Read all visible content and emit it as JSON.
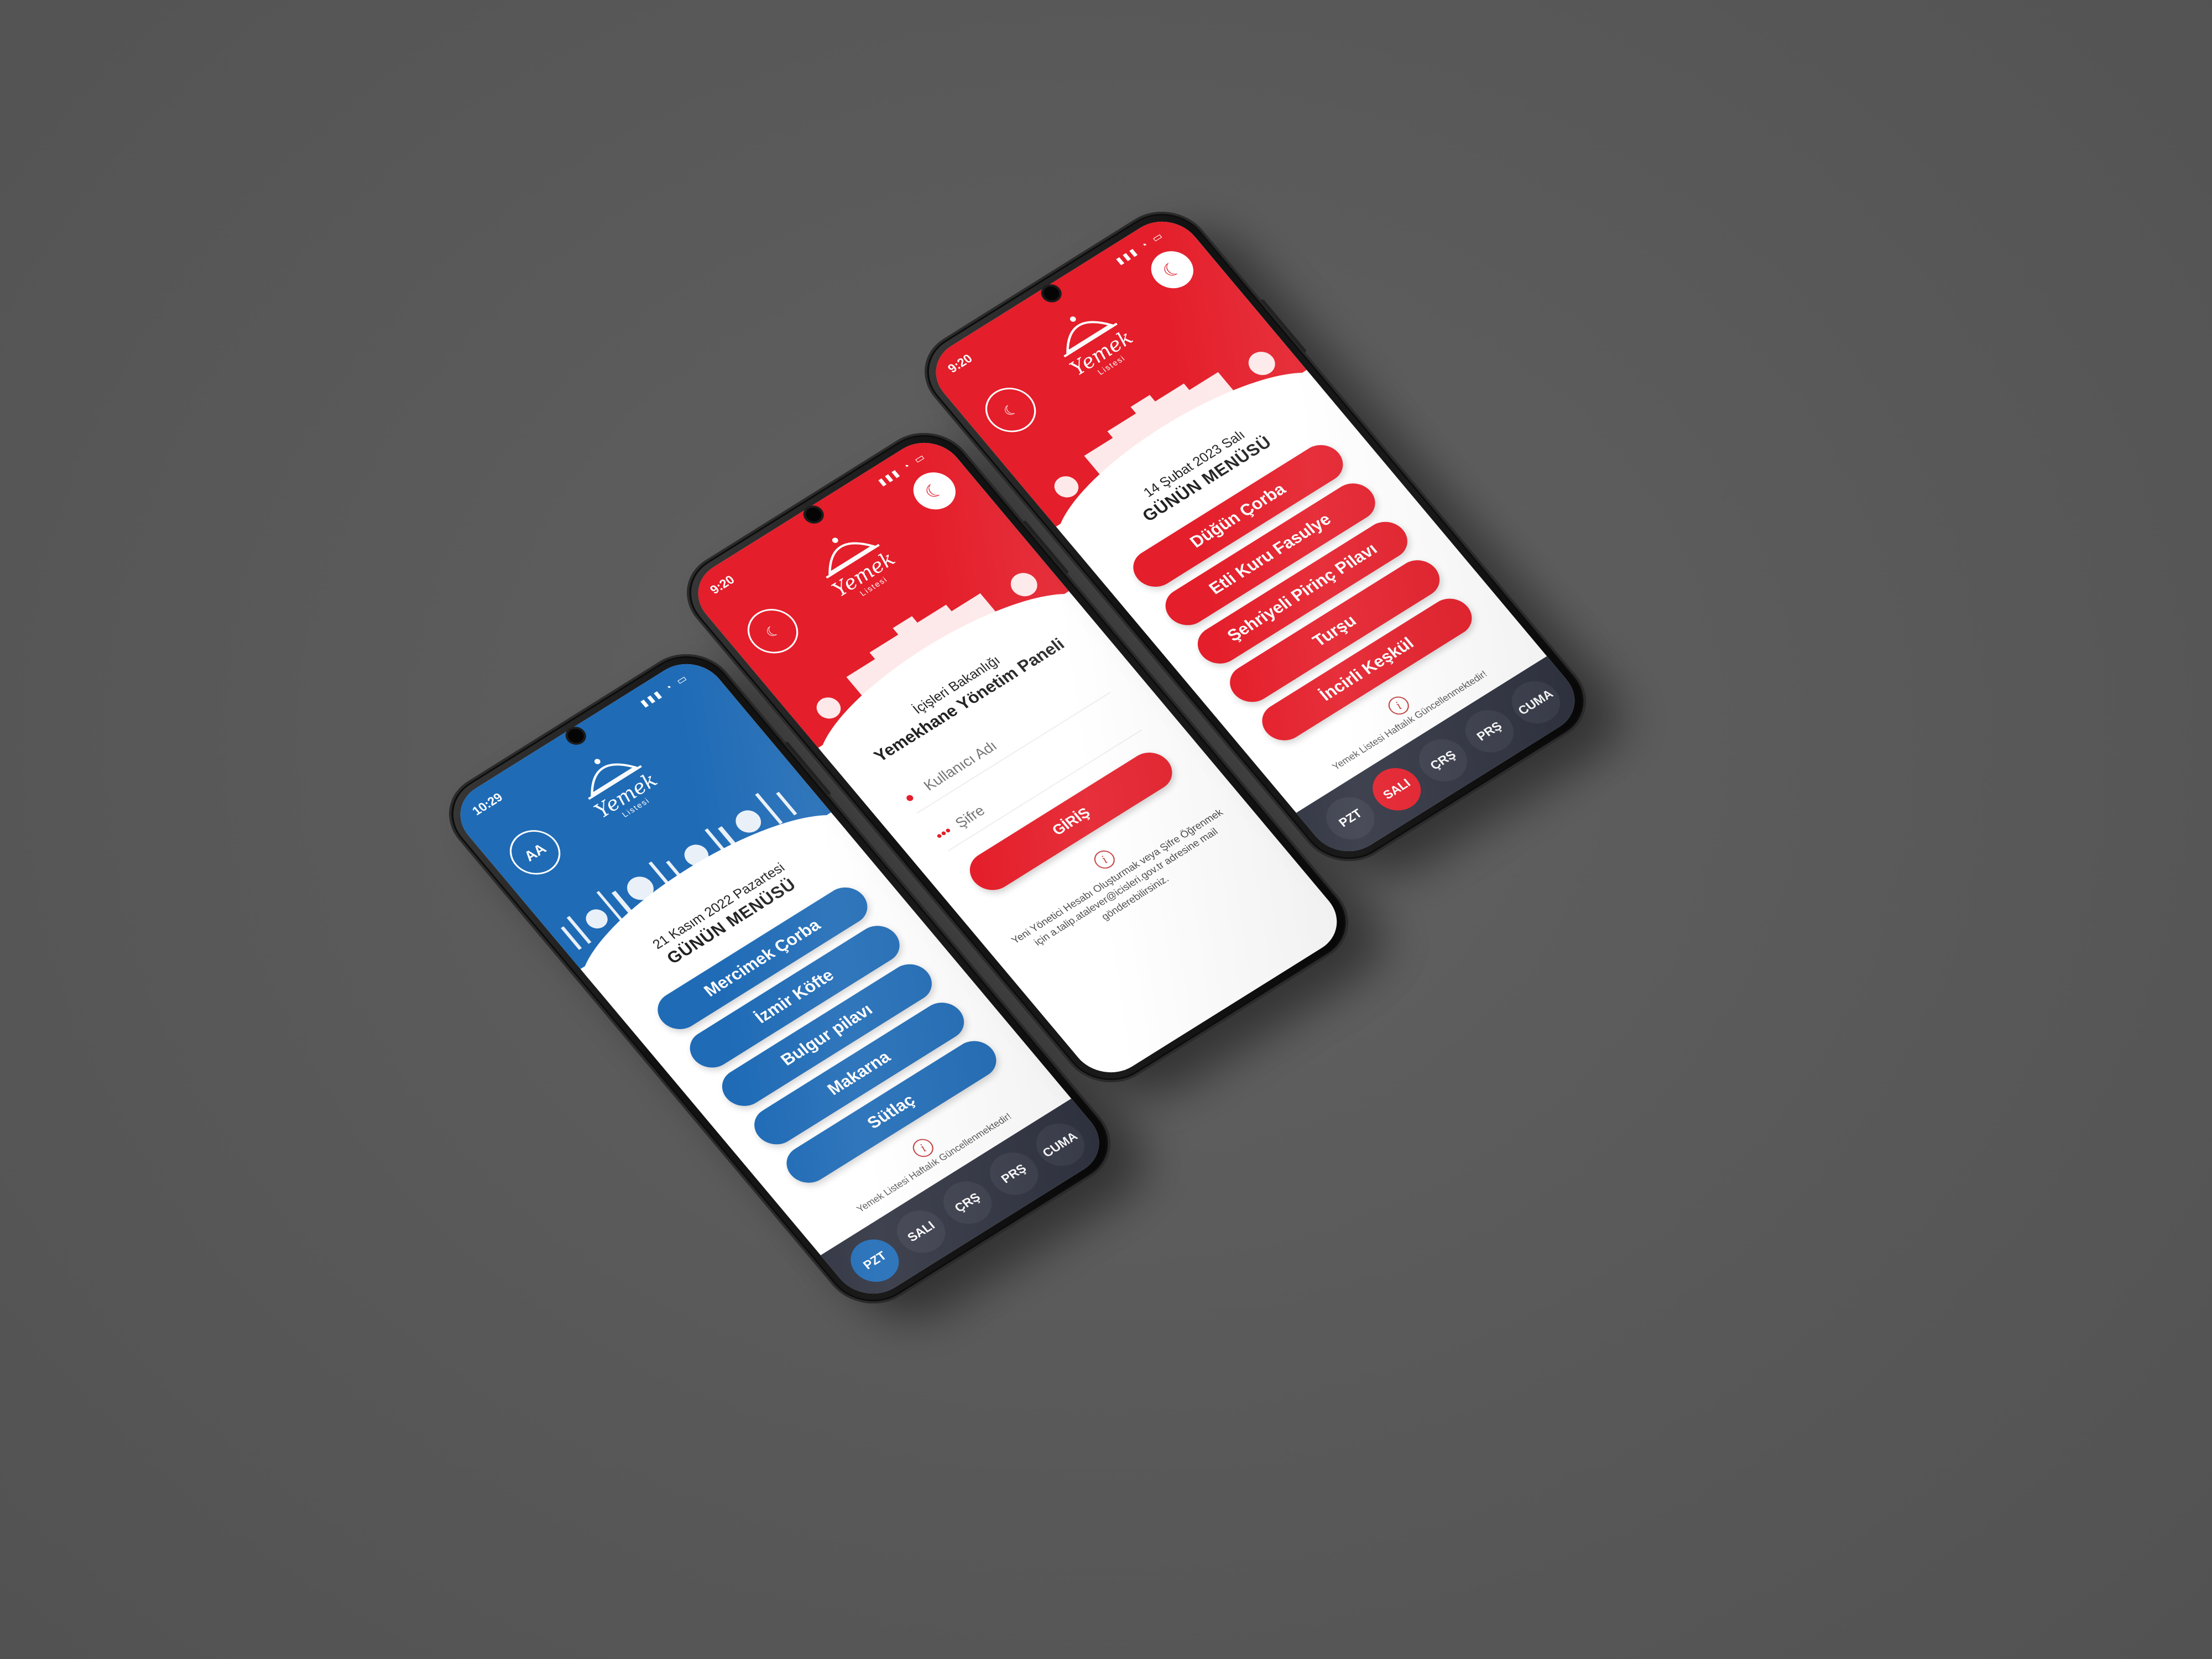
{
  "phones": {
    "blue": {
      "status_time": "10:29",
      "logo_script": "Yemek",
      "logo_sub": "Listesi",
      "org_badge": "AA",
      "date": "21 Kasım 2022 Pazartesi",
      "title": "GÜNÜN MENÜSÜ",
      "dishes": [
        "Mercimek Çorba",
        "İzmir Köfte",
        "Bulgur pilavı",
        "Makarna",
        "Sütlaç"
      ],
      "info_text": "Yemek Listesi Haftalık Güncellenmektedir!",
      "days": [
        "PZT",
        "SALI",
        "ÇRŞ",
        "PRŞ",
        "CUMA"
      ],
      "active_day": "PZT"
    },
    "login": {
      "status_time": "9:20",
      "logo_script": "Yemek",
      "logo_sub": "Listesi",
      "ministry": "İçişleri Bakanlığı",
      "title": "Yemekhane Yönetim Paneli",
      "username_placeholder": "Kullanıcı Adı",
      "password_placeholder": "Şifre",
      "login_label": "GİRİŞ",
      "note": "Yeni Yönetici Hesabı Oluşturmak veya Şifre Öğrenmek için a.talip.atalever@icisleri.gov.tr adresine mail gönderebilirsiniz."
    },
    "red": {
      "status_time": "9:20",
      "logo_script": "Yemek",
      "logo_sub": "Listesi",
      "date": "14 Şubat 2023 Salı",
      "title": "GÜNÜN MENÜSÜ",
      "dishes": [
        "Düğün Çorba",
        "Etli Kuru Fasulye",
        "Şehriyeli Pirinç Pilavı",
        "Turşu",
        "İncirli Keşkül"
      ],
      "info_text": "Yemek Listesi Haftalık Güncellenmektedir!",
      "days": [
        "PZT",
        "SALI",
        "ÇRŞ",
        "PRŞ",
        "CUMA"
      ],
      "active_day": "SALI"
    }
  },
  "colors": {
    "background": "#5a5a5a",
    "brand_red": "#e41e2a",
    "brand_blue": "#1f6bb6",
    "nav_dark": "#2f3240"
  },
  "icons": {
    "status": "signal-wifi-battery-icons",
    "user_field": "user-icon",
    "password_field": "password-dots-icon",
    "info": "info-icon",
    "flag": "turkish-flag-badge"
  }
}
